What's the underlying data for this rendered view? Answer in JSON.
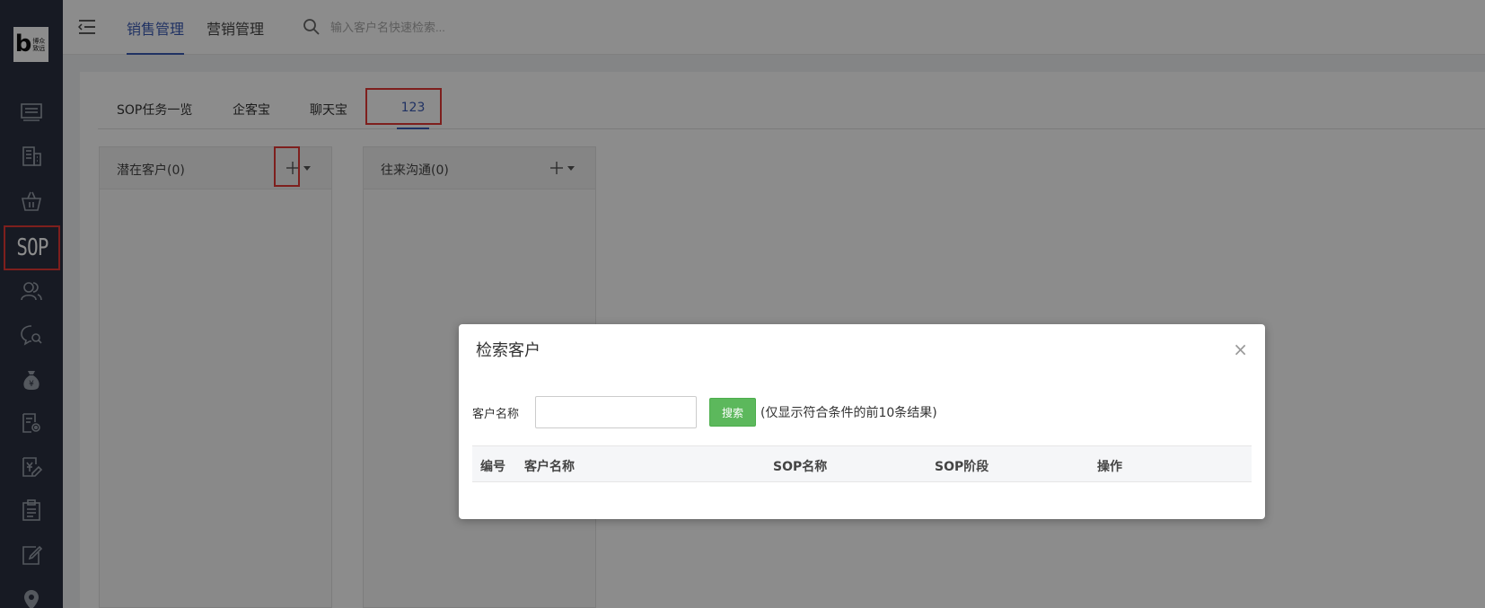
{
  "sidebar": {
    "logo_letter": "b",
    "logo_text": "博众致远",
    "sop_label": "SOP",
    "icons": [
      "monitor-icon",
      "building-icon",
      "basket-icon",
      "sop-icon",
      "users-icon",
      "chat-search-icon",
      "money-bag-icon",
      "document-settings-icon",
      "yen-edit-icon",
      "clipboard-icon",
      "edit-icon",
      "location-icon"
    ]
  },
  "header": {
    "nav": [
      "销售管理",
      "营销管理"
    ],
    "search_placeholder": "输入客户名快速检索..."
  },
  "tabs": [
    "SOP任务一览",
    "企客宝",
    "聊天宝",
    "123"
  ],
  "columns": [
    {
      "title": "潜在客户(0)"
    },
    {
      "title": "往来沟通(0)"
    }
  ],
  "dialog": {
    "title": "检索客户",
    "close": "×",
    "field_label": "客户名称",
    "input_value": "",
    "search_button": "搜索",
    "hint": "(仅显示符合条件的前10条结果)",
    "table_headers": [
      "编号",
      "客户名称",
      "SOP名称",
      "SOP阶段",
      "操作"
    ]
  }
}
